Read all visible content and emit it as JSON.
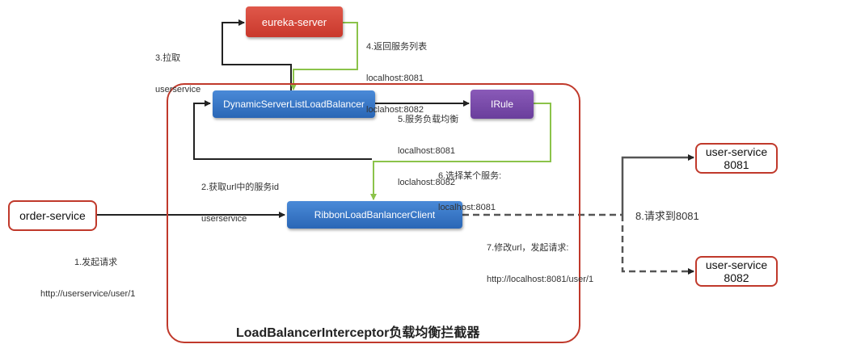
{
  "nodes": {
    "eureka": "eureka-server",
    "dynamic_lb": "DynamicServerListLoadBalancer",
    "irule": "IRule",
    "ribbon_client": "RibbonLoadBanlancerClient",
    "order_service": "order-service",
    "user_service_1": [
      "user-service",
      "8081"
    ],
    "user_service_2": [
      "user-service",
      "8082"
    ]
  },
  "frame_title": "LoadBalancerInterceptor负载均衡拦截器",
  "labels": {
    "step1": [
      "1.发起请求",
      "http://userservice/user/1"
    ],
    "step2": [
      "2.获取url中的服务id",
      "userservice"
    ],
    "step3": [
      "3.拉取",
      "userservice"
    ],
    "step4": [
      "4.返回服务列表",
      "localhost:8081",
      "loclahost:8082"
    ],
    "step5": [
      "5.服务负载均衡",
      "localhost:8081",
      "loclahost:8082"
    ],
    "step6": [
      "6.选择某个服务:",
      "localhost:8081"
    ],
    "step7": [
      "7.修改url，发起请求:",
      "http://localhost:8081/user/1"
    ],
    "step8": "8.请求到8081"
  },
  "colors": {
    "frame": "#c0392b",
    "arrow": "#222222",
    "return_arrow": "#8bc34a",
    "blue_node": "#3a78c8",
    "purple_node": "#7a4aa8",
    "eureka_node": "#d4473a"
  }
}
